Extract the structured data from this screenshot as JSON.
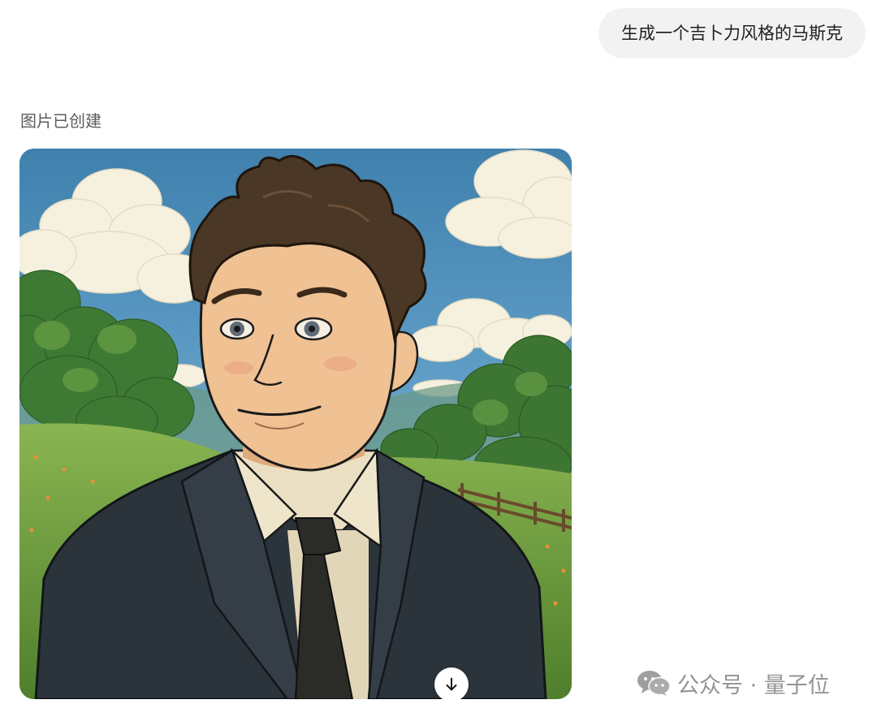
{
  "conversation": {
    "user_message": "生成一个吉卜力风格的马斯克",
    "assistant_status": "图片已创建"
  },
  "generated_image": {
    "style": "Ghibli-style anime portrait",
    "download_icon": "arrow-down-icon"
  },
  "watermark": {
    "text": "公众号 · 量子位",
    "icon": "wechat-icon"
  },
  "colors": {
    "bubble_background": "#f2f2f2",
    "sky": "#4b8bb6",
    "grass": "#6f9c3d",
    "suit": "#2b333b",
    "shirt": "#eadfc2",
    "skin": "#efc193",
    "hair": "#4a3725"
  }
}
